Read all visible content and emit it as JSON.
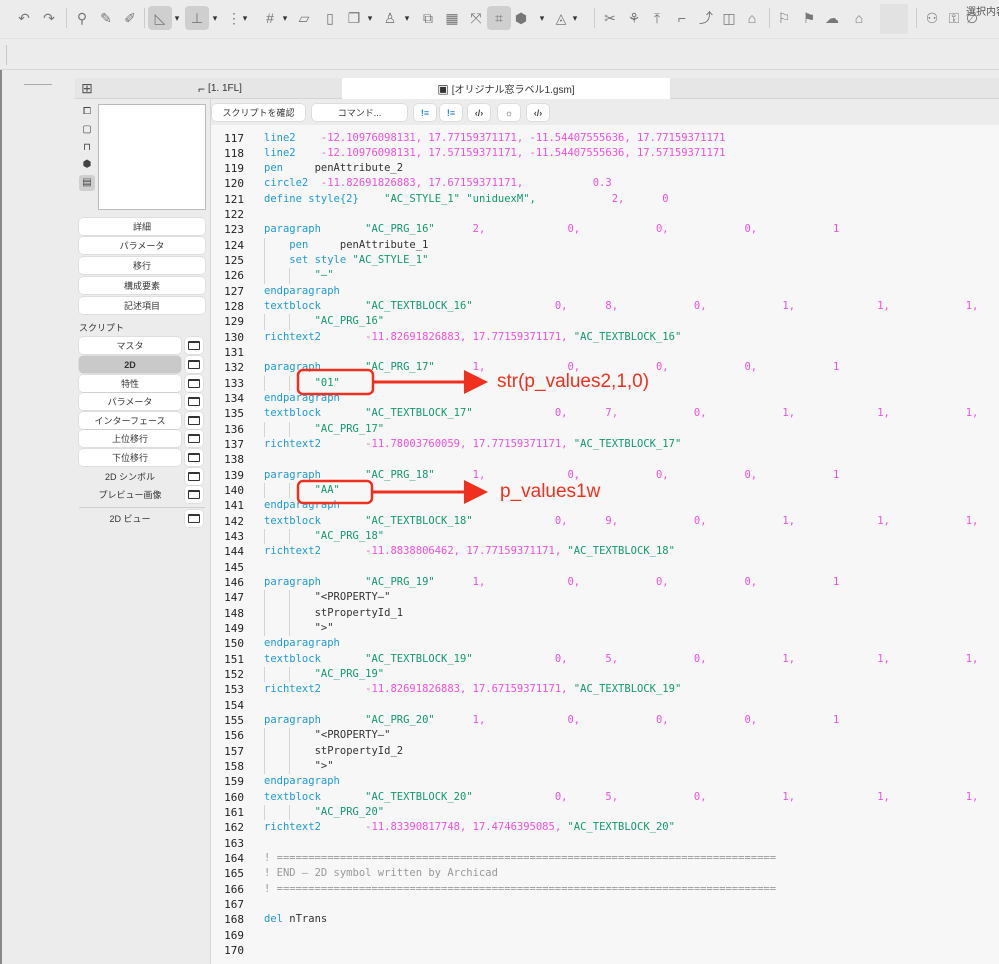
{
  "toolbar": {
    "icons": [
      "undo-icon",
      "redo-icon",
      "divider",
      "pick-parameters-icon",
      "eyedropper-icon",
      "inject-icon",
      "divider",
      "guide-triangle-icon",
      "chevron-down-icon",
      "snap-guide-icon",
      "chevron-down-icon",
      "snap-point-icon",
      "chevron-down-icon",
      "grid-icon",
      "chevron-down-icon",
      "plane-icon",
      "vertical-plane-icon",
      "layer-icon",
      "chevron-down-icon",
      "figure-icon",
      "chevron-down-icon",
      "trace-icon",
      "calendar-icon",
      "zoom-fit-icon",
      "selection-marquee-icon",
      "3d-box-icon",
      "chevron-down-icon",
      "sphere-icon",
      "chevron-down-icon",
      "divider",
      "scissors-icon",
      "magic-wand-icon",
      "elevate-icon",
      "fillet-icon",
      "curve-icon",
      "split-icon",
      "roof-icon",
      "divider",
      "flag-icon",
      "list-flag-icon",
      "cloud-sync-icon",
      "house-check-icon",
      "divider",
      "teamwork-icon",
      "lock-user-icon",
      "selection-info-icon"
    ],
    "selection_label": "選択内容"
  },
  "tabs": [
    {
      "label": "[1. 1FL]",
      "icon": "floor-plan-icon"
    },
    {
      "label": "[オリジナル窓ラベル1.gsm]",
      "icon": "gsm-object-icon"
    }
  ],
  "side_icons": [
    "2d-view-icon",
    "3d-view-icon",
    "section-icon",
    "3d-box-icon",
    "script-list-icon"
  ],
  "side_buttons": [
    "詳細",
    "パラメータ",
    "移行",
    "構成要素",
    "記述項目"
  ],
  "script_label": "スクリプト",
  "script_buttons": [
    {
      "label": "マスタ",
      "selected": false
    },
    {
      "label": "2D",
      "selected": true
    },
    {
      "label": "特性",
      "selected": false
    },
    {
      "label": "パラメータ",
      "selected": false
    },
    {
      "label": "インターフェース",
      "selected": false
    },
    {
      "label": "上位移行",
      "selected": false
    },
    {
      "label": "下位移行",
      "selected": false
    },
    {
      "label": "2D シンボル",
      "selected": false
    },
    {
      "label": "プレビュー画像",
      "selected": false
    },
    {
      "label": "2D ビュー",
      "selected": false
    }
  ],
  "script_toolbar": {
    "check_label": "スクリプトを確認",
    "command_label": "コマンド...",
    "icons": [
      "warning-list-icon",
      "error-list-icon",
      "code-convert-icon",
      "debug-light-icon",
      "code-window-icon"
    ],
    "icon_glyphs": [
      "!≡",
      "!≡",
      "‹/›",
      "☼",
      "‹/›"
    ]
  },
  "code": [
    {
      "n": 117,
      "i": 0,
      "t": [
        [
          "k",
          "line2"
        ],
        [
          "t",
          "    "
        ],
        [
          "n",
          "-12.10976098131, 17.77159371171, -11.54407555636, 17.77159371171"
        ]
      ]
    },
    {
      "n": 118,
      "i": 0,
      "t": [
        [
          "k",
          "line2"
        ],
        [
          "t",
          "    "
        ],
        [
          "n",
          "-12.10976098131, 17.57159371171, -11.54407555636, 17.57159371171"
        ]
      ]
    },
    {
      "n": 119,
      "i": 0,
      "t": [
        [
          "k",
          "pen"
        ],
        [
          "t",
          "     penAttribute_2"
        ]
      ]
    },
    {
      "n": 120,
      "i": 0,
      "t": [
        [
          "k",
          "circle2"
        ],
        [
          "t",
          "  "
        ],
        [
          "n",
          "-11.82691826883, 17.67159371171,           0.3"
        ]
      ]
    },
    {
      "n": 121,
      "i": 0,
      "t": [
        [
          "k",
          "define style{2}"
        ],
        [
          "t",
          "    "
        ],
        [
          "s",
          "\"AC_STYLE_1\" \"uniduexM\","
        ],
        [
          "n",
          "            2,      0"
        ]
      ]
    },
    {
      "n": 122,
      "i": 0,
      "t": []
    },
    {
      "n": 123,
      "i": 0,
      "t": [
        [
          "k",
          "paragraph"
        ],
        [
          "t",
          "       "
        ],
        [
          "s",
          "\"AC_PRG_16\""
        ],
        [
          "n",
          "      2,             0,            0,            0,            1"
        ]
      ]
    },
    {
      "n": 124,
      "i": 1,
      "t": [
        [
          "k",
          "pen"
        ],
        [
          "t",
          "     penAttribute_1"
        ]
      ]
    },
    {
      "n": 125,
      "i": 1,
      "t": [
        [
          "k",
          "set style"
        ],
        [
          "t",
          " "
        ],
        [
          "s",
          "\"AC_STYLE_1\""
        ]
      ]
    },
    {
      "n": 126,
      "i": 2,
      "t": [
        [
          "s",
          "\"—\""
        ]
      ]
    },
    {
      "n": 127,
      "i": 0,
      "t": [
        [
          "k",
          "endparagraph"
        ]
      ]
    },
    {
      "n": 128,
      "i": 0,
      "t": [
        [
          "k",
          "textblock"
        ],
        [
          "t",
          "       "
        ],
        [
          "s",
          "\"AC_TEXTBLOCK_16\""
        ],
        [
          "n",
          "             0,      8,            0,            1,             1,            1,"
        ]
      ]
    },
    {
      "n": 129,
      "i": 2,
      "t": [
        [
          "s",
          "\"AC_PRG_16\""
        ]
      ]
    },
    {
      "n": 130,
      "i": 0,
      "t": [
        [
          "k",
          "richtext2"
        ],
        [
          "t",
          "       "
        ],
        [
          "n",
          "-11.82691826883, 17.77159371171, "
        ],
        [
          "s",
          "\"AC_TEXTBLOCK_16\""
        ]
      ]
    },
    {
      "n": 131,
      "i": 0,
      "t": []
    },
    {
      "n": 132,
      "i": 0,
      "t": [
        [
          "k",
          "paragraph"
        ],
        [
          "t",
          "       "
        ],
        [
          "s",
          "\"AC_PRG_17\""
        ],
        [
          "n",
          "      1,             0,            0,            0,            1"
        ]
      ]
    },
    {
      "n": 133,
      "i": 2,
      "t": [
        [
          "s",
          "\"01\""
        ]
      ]
    },
    {
      "n": 134,
      "i": 0,
      "t": [
        [
          "k",
          "endparagraph"
        ]
      ]
    },
    {
      "n": 135,
      "i": 0,
      "t": [
        [
          "k",
          "textblock"
        ],
        [
          "t",
          "       "
        ],
        [
          "s",
          "\"AC_TEXTBLOCK_17\""
        ],
        [
          "n",
          "             0,      7,            0,            1,             1,            1,"
        ]
      ]
    },
    {
      "n": 136,
      "i": 2,
      "t": [
        [
          "s",
          "\"AC_PRG_17\""
        ]
      ]
    },
    {
      "n": 137,
      "i": 0,
      "t": [
        [
          "k",
          "richtext2"
        ],
        [
          "t",
          "       "
        ],
        [
          "n",
          "-11.78003760059, 17.77159371171, "
        ],
        [
          "s",
          "\"AC_TEXTBLOCK_17\""
        ]
      ]
    },
    {
      "n": 138,
      "i": 0,
      "t": []
    },
    {
      "n": 139,
      "i": 0,
      "t": [
        [
          "k",
          "paragraph"
        ],
        [
          "t",
          "       "
        ],
        [
          "s",
          "\"AC_PRG_18\""
        ],
        [
          "n",
          "      1,             0,            0,            0,            1"
        ]
      ]
    },
    {
      "n": 140,
      "i": 2,
      "t": [
        [
          "s",
          "\"AA\""
        ]
      ]
    },
    {
      "n": 141,
      "i": 0,
      "t": [
        [
          "k",
          "endparagraph"
        ]
      ]
    },
    {
      "n": 142,
      "i": 0,
      "t": [
        [
          "k",
          "textblock"
        ],
        [
          "t",
          "       "
        ],
        [
          "s",
          "\"AC_TEXTBLOCK_18\""
        ],
        [
          "n",
          "             0,      9,            0,            1,             1,            1,"
        ]
      ]
    },
    {
      "n": 143,
      "i": 2,
      "t": [
        [
          "s",
          "\"AC_PRG_18\""
        ]
      ]
    },
    {
      "n": 144,
      "i": 0,
      "t": [
        [
          "k",
          "richtext2"
        ],
        [
          "t",
          "       "
        ],
        [
          "n",
          "-11.8838806462, 17.77159371171, "
        ],
        [
          "s",
          "\"AC_TEXTBLOCK_18\""
        ]
      ]
    },
    {
      "n": 145,
      "i": 0,
      "t": []
    },
    {
      "n": 146,
      "i": 0,
      "t": [
        [
          "k",
          "paragraph"
        ],
        [
          "t",
          "       "
        ],
        [
          "s",
          "\"AC_PRG_19\""
        ],
        [
          "n",
          "      1,             0,            0,            0,            1"
        ]
      ]
    },
    {
      "n": 147,
      "i": 2,
      "t": [
        [
          "t",
          "\"<PROPERTY—\""
        ]
      ]
    },
    {
      "n": 148,
      "i": 2,
      "t": [
        [
          "t",
          "stPropertyId_1"
        ]
      ]
    },
    {
      "n": 149,
      "i": 2,
      "t": [
        [
          "t",
          "\">\""
        ]
      ]
    },
    {
      "n": 150,
      "i": 0,
      "t": [
        [
          "k",
          "endparagraph"
        ]
      ]
    },
    {
      "n": 151,
      "i": 0,
      "t": [
        [
          "k",
          "textblock"
        ],
        [
          "t",
          "       "
        ],
        [
          "s",
          "\"AC_TEXTBLOCK_19\""
        ],
        [
          "n",
          "             0,      5,            0,            1,             1,            1,"
        ]
      ]
    },
    {
      "n": 152,
      "i": 2,
      "t": [
        [
          "s",
          "\"AC_PRG_19\""
        ]
      ]
    },
    {
      "n": 153,
      "i": 0,
      "t": [
        [
          "k",
          "richtext2"
        ],
        [
          "t",
          "       "
        ],
        [
          "n",
          "-11.82691826883, 17.67159371171, "
        ],
        [
          "s",
          "\"AC_TEXTBLOCK_19\""
        ]
      ]
    },
    {
      "n": 154,
      "i": 0,
      "t": []
    },
    {
      "n": 155,
      "i": 0,
      "t": [
        [
          "k",
          "paragraph"
        ],
        [
          "t",
          "       "
        ],
        [
          "s",
          "\"AC_PRG_20\""
        ],
        [
          "n",
          "      1,             0,            0,            0,            1"
        ]
      ]
    },
    {
      "n": 156,
      "i": 2,
      "t": [
        [
          "t",
          "\"<PROPERTY—\""
        ]
      ]
    },
    {
      "n": 157,
      "i": 2,
      "t": [
        [
          "t",
          "stPropertyId_2"
        ]
      ]
    },
    {
      "n": 158,
      "i": 2,
      "t": [
        [
          "t",
          "\">\""
        ]
      ]
    },
    {
      "n": 159,
      "i": 0,
      "t": [
        [
          "k",
          "endparagraph"
        ]
      ]
    },
    {
      "n": 160,
      "i": 0,
      "t": [
        [
          "k",
          "textblock"
        ],
        [
          "t",
          "       "
        ],
        [
          "s",
          "\"AC_TEXTBLOCK_20\""
        ],
        [
          "n",
          "             0,      5,            0,            1,             1,            1,"
        ]
      ]
    },
    {
      "n": 161,
      "i": 2,
      "t": [
        [
          "s",
          "\"AC_PRG_20\""
        ]
      ]
    },
    {
      "n": 162,
      "i": 0,
      "t": [
        [
          "k",
          "richtext2"
        ],
        [
          "t",
          "       "
        ],
        [
          "n",
          "-11.83390817748, 17.4746395085, "
        ],
        [
          "s",
          "\"AC_TEXTBLOCK_20\""
        ]
      ]
    },
    {
      "n": 163,
      "i": 0,
      "t": []
    },
    {
      "n": 164,
      "i": 0,
      "t": [
        [
          "c",
          "! ==============================================================================="
        ]
      ]
    },
    {
      "n": 165,
      "i": 0,
      "t": [
        [
          "c",
          "! END — 2D symbol written by Archicad"
        ]
      ]
    },
    {
      "n": 166,
      "i": 0,
      "t": [
        [
          "c",
          "! ==============================================================================="
        ]
      ]
    },
    {
      "n": 167,
      "i": 0,
      "t": []
    },
    {
      "n": 168,
      "i": 0,
      "t": [
        [
          "k",
          "del"
        ],
        [
          "t",
          " nTrans"
        ]
      ]
    },
    {
      "n": 169,
      "i": 0,
      "t": []
    },
    {
      "n": 170,
      "i": 0,
      "t": []
    }
  ],
  "annotations": [
    {
      "target_line": 133,
      "label": "str(p_values2,1,0)"
    },
    {
      "target_line": 140,
      "label": "p_values1w"
    }
  ],
  "colors": {
    "keyword": "#1e9ad6",
    "number": "#f050e0",
    "string": "#129b6a",
    "annotation": "#f0301e",
    "selected": "#c9c9c9"
  }
}
